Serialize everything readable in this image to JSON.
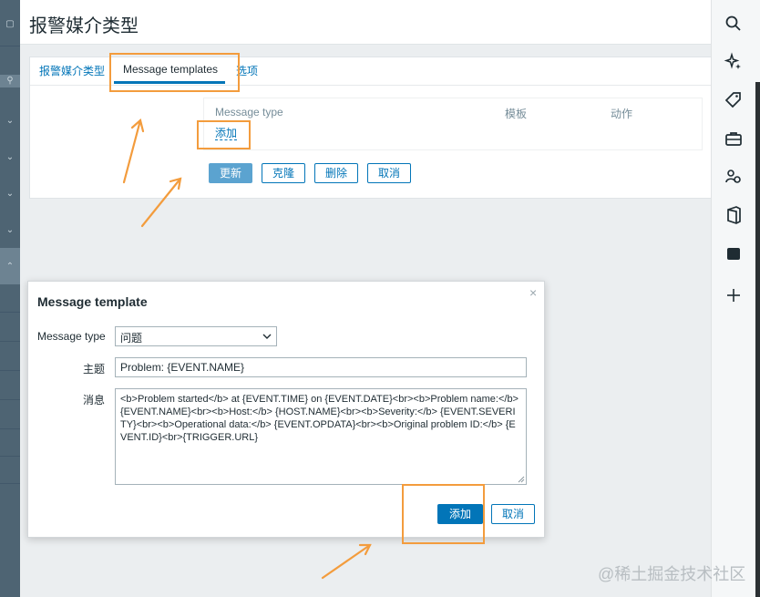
{
  "page": {
    "title": "报警媒介类型",
    "tabs": [
      {
        "label": "报警媒介类型"
      },
      {
        "label": "Message templates"
      },
      {
        "label": "选项"
      }
    ],
    "table": {
      "headers": [
        "Message type",
        "模板",
        "动作"
      ],
      "add_link": "添加"
    },
    "buttons": {
      "update": "更新",
      "clone": "克隆",
      "delete": "删除",
      "cancel": "取消"
    }
  },
  "dialog": {
    "title": "Message template",
    "close": "×",
    "fields": {
      "message_type_label": "Message type",
      "message_type_value": "问题",
      "subject_label": "主题",
      "subject_value": "Problem: {EVENT.NAME}",
      "message_label": "消息",
      "message_value": "<b>Problem started</b> at {EVENT.TIME} on {EVENT.DATE}<br><b>Problem name:</b> {EVENT.NAME}<br><b>Host:</b> {HOST.NAME}<br><b>Severity:</b> {EVENT.SEVERITY}<br><b>Operational data:</b> {EVENT.OPDATA}<br><b>Original problem ID:</b> {EVENT.ID}<br>{TRIGGER.URL}"
    },
    "buttons": {
      "add": "添加",
      "cancel": "取消"
    }
  },
  "right_sidebar": {
    "icons": [
      "search-icon",
      "sparkle-icon",
      "tag-icon",
      "briefcase-icon",
      "people-icon",
      "office-icon",
      "square-icon",
      "plus-icon"
    ]
  },
  "watermark": "@稀土掘金技术社区",
  "colors": {
    "accent": "#0275b8",
    "highlight": "#f39c3d",
    "left_nav": "#4e6473"
  }
}
